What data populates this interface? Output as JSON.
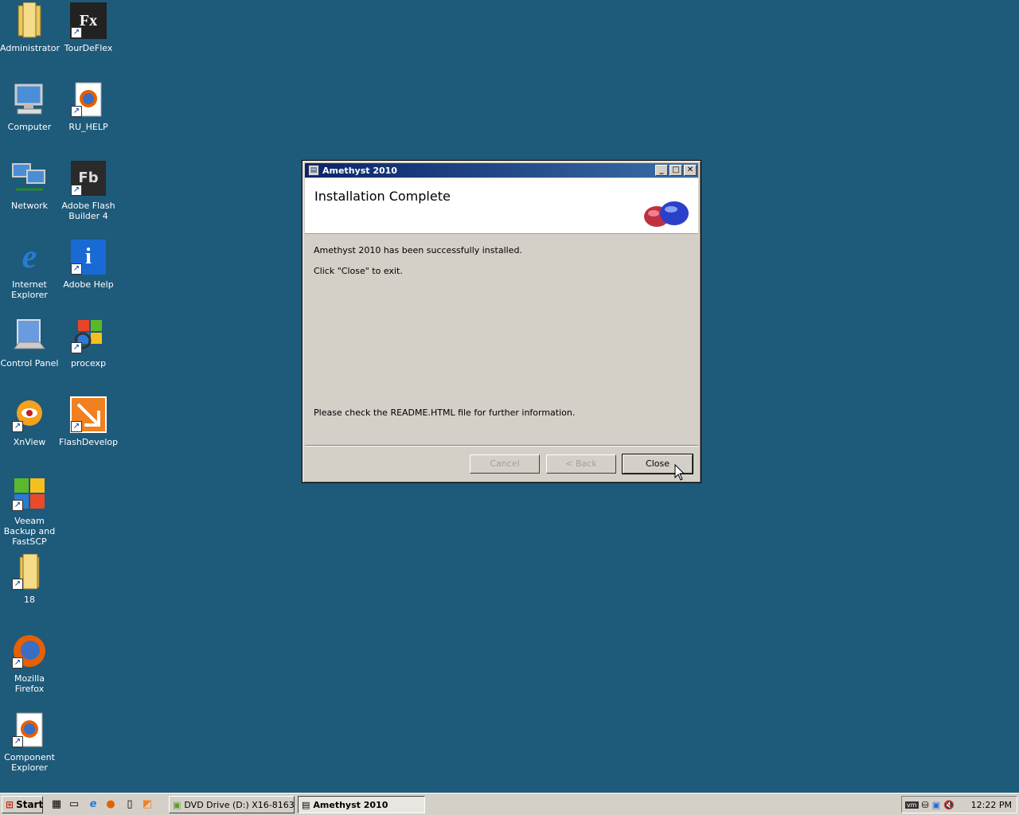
{
  "desktop": {
    "icons": [
      {
        "label": "Administrator",
        "icon": "folder-user-icon"
      },
      {
        "label": "TourDeFlex",
        "icon": "tour-de-flex-icon"
      },
      {
        "label": "Computer",
        "icon": "computer-icon"
      },
      {
        "label": "RU_HELP",
        "icon": "firefox-document-icon"
      },
      {
        "label": "Network",
        "icon": "network-icon"
      },
      {
        "label": "Adobe Flash Builder 4",
        "icon": "flash-builder-icon"
      },
      {
        "label": "Internet Explorer",
        "icon": "internet-explorer-icon"
      },
      {
        "label": "Adobe Help",
        "icon": "adobe-help-icon"
      },
      {
        "label": "Control Panel",
        "icon": "control-panel-icon"
      },
      {
        "label": "procexp",
        "icon": "process-explorer-icon"
      },
      {
        "label": "XnView",
        "icon": "xnview-icon"
      },
      {
        "label": "FlashDevelop",
        "icon": "flashdevelop-icon"
      },
      {
        "label": "Veeam Backup and FastSCP",
        "icon": "veeam-icon"
      },
      {
        "label": "18",
        "icon": "folder-icon"
      },
      {
        "label": "Mozilla Firefox",
        "icon": "firefox-icon"
      },
      {
        "label": "Component Explorer",
        "icon": "firefox-document-icon"
      }
    ]
  },
  "dialog": {
    "title": "Amethyst 2010",
    "heading": "Installation Complete",
    "line1": "Amethyst 2010 has been successfully installed.",
    "line2": "Click \"Close\" to exit.",
    "line3": "Please check the README.HTML file for further information.",
    "cancel_label": "Cancel",
    "back_label": "< Back",
    "close_label": "Close",
    "minimize": "_",
    "maximize": "□",
    "close_x": "✕"
  },
  "taskbar": {
    "start_label": "Start",
    "tasks": [
      {
        "label": "DVD Drive (D:) X16-8163..."
      },
      {
        "label": "Amethyst 2010"
      }
    ],
    "clock": "12:22 PM"
  },
  "colors": {
    "desktop": "#1e5a7a",
    "titlebar_start": "#0a246a",
    "titlebar_end": "#3a6ea5"
  }
}
